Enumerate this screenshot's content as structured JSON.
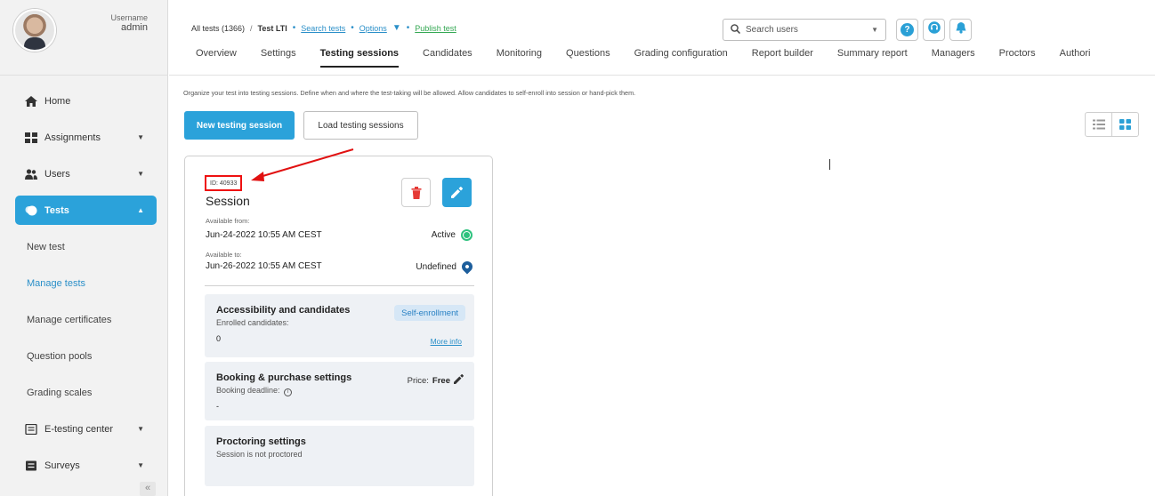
{
  "user": {
    "label": "Username",
    "name": "admin"
  },
  "sidebar": {
    "items": [
      {
        "label": "Home"
      },
      {
        "label": "Assignments"
      },
      {
        "label": "Users"
      },
      {
        "label": "Tests"
      }
    ],
    "sub_items": [
      {
        "label": "New test"
      },
      {
        "label": "Manage tests"
      },
      {
        "label": "Manage certificates"
      },
      {
        "label": "Question pools"
      },
      {
        "label": "Grading scales"
      }
    ],
    "more_items": [
      {
        "label": "E-testing center"
      },
      {
        "label": "Surveys"
      }
    ],
    "collapse_label": "«"
  },
  "breadcrumb": {
    "all_tests": "All tests (1366)",
    "separator": "/",
    "current": "Test LTI",
    "search_tests": "Search tests",
    "options": "Options",
    "publish": "Publish test"
  },
  "tabs": [
    "Overview",
    "Settings",
    "Testing sessions",
    "Candidates",
    "Monitoring",
    "Questions",
    "Grading configuration",
    "Report builder",
    "Summary report",
    "Managers",
    "Proctors",
    "Authori"
  ],
  "search": {
    "placeholder": "Search users"
  },
  "main": {
    "intro": "Organize your test into testing sessions. Define when and where the test-taking will be allowed. Allow candidates to self-enroll into session or hand-pick them.",
    "new_session": "New testing session",
    "load_sessions": "Load testing sessions"
  },
  "session": {
    "id": "ID: 40933",
    "title": "Session",
    "available_from_label": "Available from:",
    "available_from": "Jun-24-2022 10:55 AM CEST",
    "status_active": "Active",
    "available_to_label": "Available to:",
    "available_to": "Jun-26-2022 10:55 AM CEST",
    "status_location": "Undefined",
    "accessibility": {
      "title": "Accessibility and candidates",
      "pill": "Self-enrollment",
      "enrolled_label": "Enrolled candidates:",
      "enrolled_value": "0",
      "more_info": "More info"
    },
    "booking": {
      "title": "Booking & purchase settings",
      "price_label": "Price:",
      "price_value": "Free",
      "deadline_label": "Booking deadline:",
      "deadline_value": "-"
    },
    "proctoring": {
      "title": "Proctoring settings",
      "status": "Session is not proctored"
    }
  },
  "colors": {
    "accent": "#2ba2da",
    "annotation": "#e11111",
    "active_green": "#2ec27e"
  }
}
